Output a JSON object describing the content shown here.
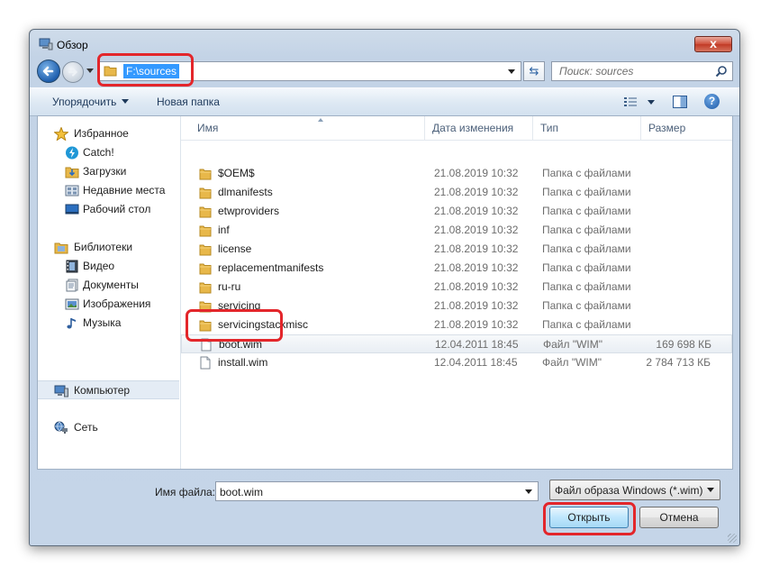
{
  "window": {
    "title": "Обзор",
    "close_label": "x"
  },
  "address": {
    "path": "F:\\sources"
  },
  "search": {
    "placeholder": "Поиск: sources"
  },
  "toolbar": {
    "organize_label": "Упорядочить",
    "new_folder_label": "Новая папка"
  },
  "navigation": {
    "favorites": {
      "label": "Избранное",
      "items": [
        "Catch!",
        "Загрузки",
        "Недавние места",
        "Рабочий стол"
      ]
    },
    "libraries": {
      "label": "Библиотеки",
      "items": [
        "Видео",
        "Документы",
        "Изображения",
        "Музыка"
      ]
    },
    "computer": "Компьютер",
    "network": "Сеть"
  },
  "columns": {
    "name": "Имя",
    "date": "Дата изменения",
    "type": "Тип",
    "size": "Размер"
  },
  "files": [
    {
      "name": "$OEM$",
      "date": "21.08.2019 10:32",
      "type": "Папка с файлами",
      "size": "",
      "kind": "folder"
    },
    {
      "name": "dlmanifests",
      "date": "21.08.2019 10:32",
      "type": "Папка с файлами",
      "size": "",
      "kind": "folder"
    },
    {
      "name": "etwproviders",
      "date": "21.08.2019 10:32",
      "type": "Папка с файлами",
      "size": "",
      "kind": "folder"
    },
    {
      "name": "inf",
      "date": "21.08.2019 10:32",
      "type": "Папка с файлами",
      "size": "",
      "kind": "folder"
    },
    {
      "name": "license",
      "date": "21.08.2019 10:32",
      "type": "Папка с файлами",
      "size": "",
      "kind": "folder"
    },
    {
      "name": "replacementmanifests",
      "date": "21.08.2019 10:32",
      "type": "Папка с файлами",
      "size": "",
      "kind": "folder"
    },
    {
      "name": "ru-ru",
      "date": "21.08.2019 10:32",
      "type": "Папка с файлами",
      "size": "",
      "kind": "folder"
    },
    {
      "name": "servicing",
      "date": "21.08.2019 10:32",
      "type": "Папка с файлами",
      "size": "",
      "kind": "folder"
    },
    {
      "name": "servicingstackmisc",
      "date": "21.08.2019 10:32",
      "type": "Папка с файлами",
      "size": "",
      "kind": "folder"
    },
    {
      "name": "boot.wim",
      "date": "12.04.2011 18:45",
      "type": "Файл \"WIM\"",
      "size": "169 698 КБ",
      "kind": "file"
    },
    {
      "name": "install.wim",
      "date": "12.04.2011 18:45",
      "type": "Файл \"WIM\"",
      "size": "2 784 713 КБ",
      "kind": "file"
    }
  ],
  "footer": {
    "filename_label": "Имя файла:",
    "filename_value": "boot.wim",
    "filetype_value": "Файл образа Windows (*.wim)",
    "open_label": "Открыть",
    "cancel_label": "Отмена"
  },
  "colors": {
    "highlight_mark": "#e3262b",
    "selection": "#3399ff",
    "folder": "#e8b84a"
  }
}
